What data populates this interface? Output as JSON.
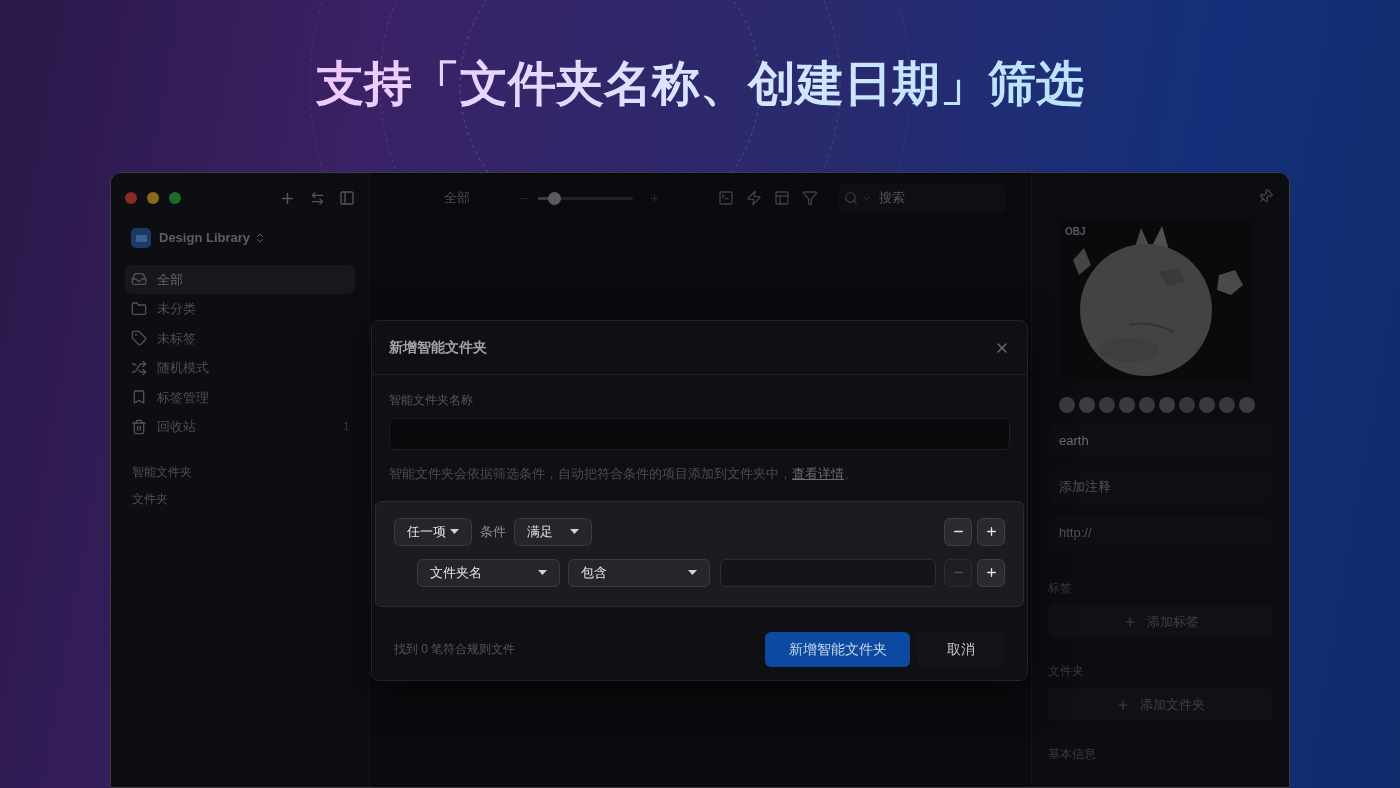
{
  "headline": "支持「文件夹名称、创建日期」筛选",
  "sidebar": {
    "library": "Design Library",
    "items": [
      {
        "label": "全部",
        "selected": true
      },
      {
        "label": "未分类",
        "selected": false
      },
      {
        "label": "未标签",
        "selected": false
      },
      {
        "label": "随机模式",
        "selected": false
      },
      {
        "label": "标签管理",
        "selected": false
      },
      {
        "label": "回收站",
        "selected": false,
        "count": "1"
      }
    ],
    "sections": [
      "智能文件夹",
      "文件夹"
    ]
  },
  "toolbar": {
    "title": "全部",
    "zoom": {
      "level": 0.15
    },
    "search": {
      "placeholder": "搜索"
    }
  },
  "dialog": {
    "title": "新增智能文件夹",
    "name_label": "智能文件夹名称",
    "help": {
      "text": "智能文件夹会依据筛选条件，自动把符合条件的项目添加到文件夹中，",
      "link": "查看详情",
      "end": "。"
    },
    "rule_group": {
      "match": "任一项",
      "label": "条件",
      "mode": "满足",
      "remove_disabled": false
    },
    "rules": [
      {
        "field": "文件夹名",
        "operator": "包含",
        "remove_disabled": true
      }
    ],
    "result": "找到 0 笔符合规则文件",
    "buttons": [
      {
        "label": "新增智能文件夹",
        "kind": "primary"
      },
      {
        "label": "取消",
        "kind": "secondary"
      }
    ]
  },
  "inspector": {
    "badge": "OBJ",
    "swatches": [
      {
        "color": "#3a3a3d"
      },
      {
        "color": "#3c3c3f"
      },
      {
        "color": "#38383b"
      },
      {
        "color": "#3b3b3e"
      },
      {
        "color": "#39393c"
      },
      {
        "color": "#3d3d40"
      },
      {
        "color": "#37373a"
      },
      {
        "color": "#3a3a3e"
      },
      {
        "color": "#38383c"
      },
      {
        "color": "#3c3c40"
      }
    ],
    "fields": [
      {
        "value": "earth"
      },
      {
        "placeholder": "添加注释"
      },
      {
        "placeholder": "http://"
      }
    ],
    "sections": [
      {
        "title": "标签",
        "action": "添加标签"
      },
      {
        "title": "文件夹",
        "action": "添加文件夹"
      },
      {
        "title": "基本信息"
      }
    ]
  }
}
